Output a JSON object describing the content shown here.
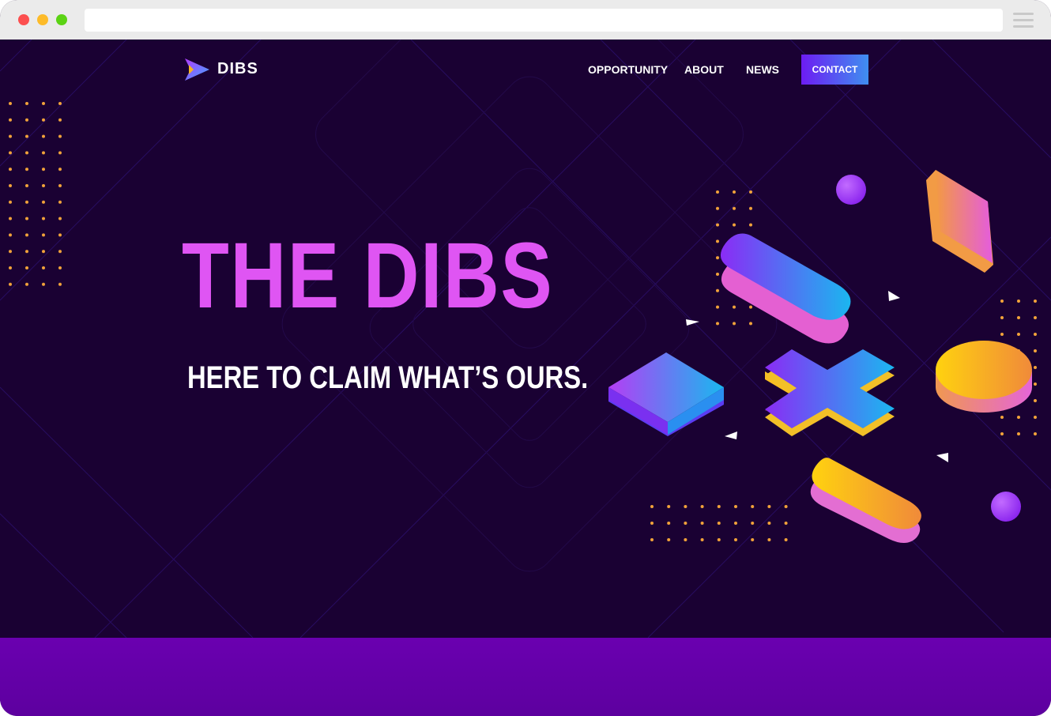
{
  "nav": {
    "brand": "DIBS",
    "links": [
      "OPPORTUNITY",
      "ABOUT",
      "NEWS"
    ],
    "contact_label": "CONTACT"
  },
  "hero": {
    "title": "THE DIBS",
    "subtitle": "HERE TO CLAIM WHAT’S OURS."
  },
  "colors": {
    "background": "#1a0133",
    "title": "#df55f3",
    "accent_purple": "#6d1cf3",
    "accent_blue": "#3f8ff0",
    "dots": "#f2a33a",
    "footer_band": "#6a00b0"
  },
  "icons": {
    "logo": "dibs-play-logo-icon",
    "menu": "hamburger-menu-icon"
  }
}
